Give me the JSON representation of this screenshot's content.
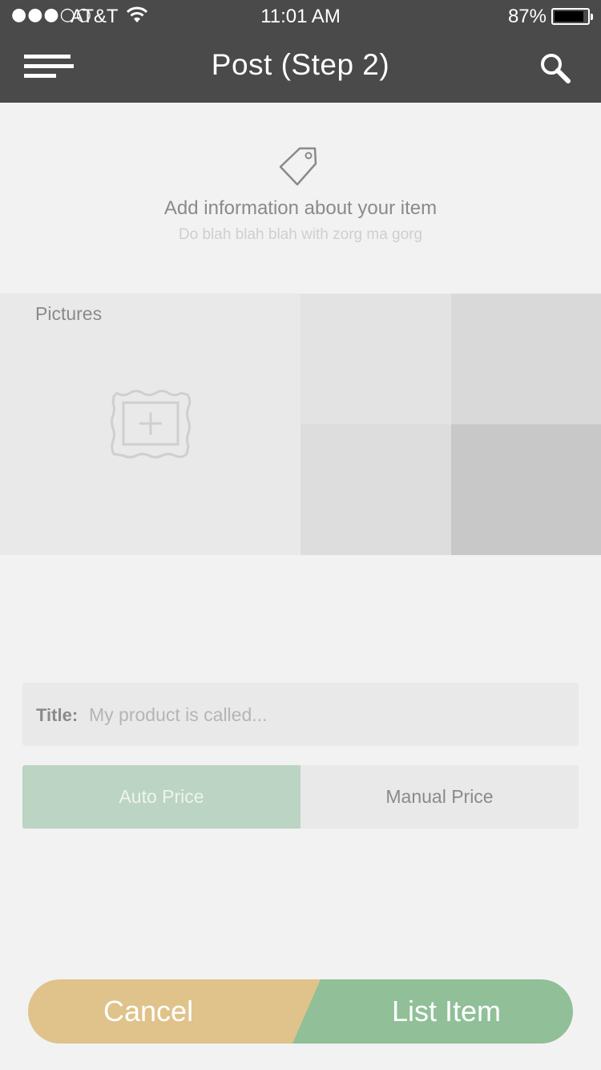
{
  "status_bar": {
    "signal": "●●●○○",
    "carrier": "AT&T",
    "time": "11:01 AM",
    "battery_percent": "87%",
    "battery_level": 0.87
  },
  "header": {
    "title": "Post (Step 2)",
    "menu_icon": "hamburger-menu-icon",
    "search_icon": "search-icon"
  },
  "intro": {
    "icon": "price-tag-icon",
    "title": "Add information about your item",
    "subtitle": "Do blah blah blah with zorg ma gorg"
  },
  "pictures": {
    "label": "Pictures",
    "add_icon": "add-picture-frame-icon"
  },
  "title_field": {
    "label": "Title:",
    "value": "",
    "placeholder": "My product is called..."
  },
  "price_toggle": {
    "options": [
      "Auto Price",
      "Manual Price"
    ],
    "selected": "Auto Price"
  },
  "actions": {
    "cancel_label": "Cancel",
    "list_label": "List Item"
  },
  "colors": {
    "header_bg": "#4a4a4a",
    "page_bg": "#f2f2f2",
    "auto_price_selected": "#bcd4c3",
    "cancel_button": "#dfc38b",
    "list_item_button": "#90bf98"
  }
}
